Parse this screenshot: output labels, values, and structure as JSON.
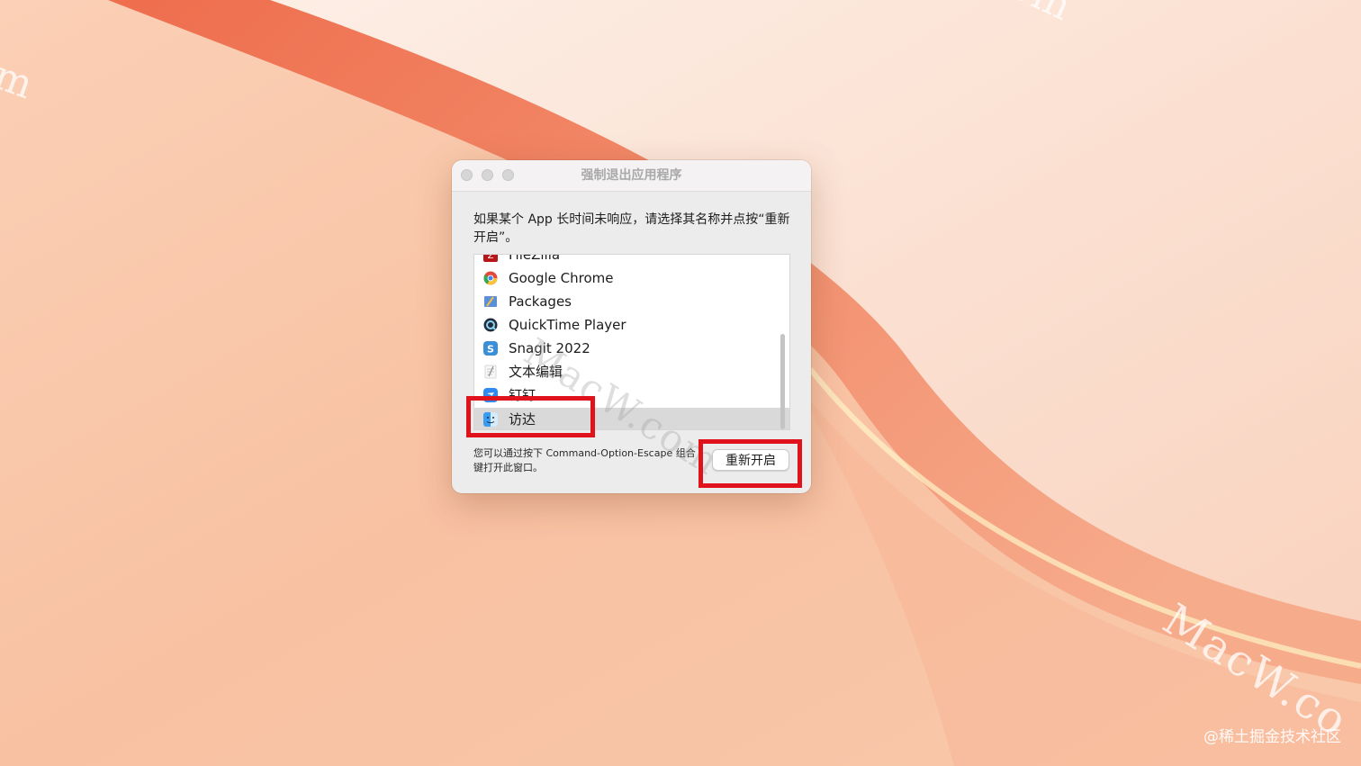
{
  "wallpaper": {
    "colors": [
      "#fbd3bc",
      "#f9c4a3",
      "#f38a6b",
      "#fdebe1"
    ]
  },
  "watermarks": {
    "top_left": "m",
    "top_right": "om",
    "bottom_right": "MacW.co",
    "center": "MacW.com"
  },
  "credit": "@稀土掘金技术社区",
  "dialog": {
    "title": "强制退出应用程序",
    "message": "如果某个 App 长时间未响应，请选择其名称并点按“重新开启”。",
    "apps": [
      {
        "label": "FileZilla",
        "icon": "filezilla-icon",
        "color": "#b8161b"
      },
      {
        "label": "Google Chrome",
        "icon": "chrome-icon",
        "color": "#4285f4"
      },
      {
        "label": "Packages",
        "icon": "packages-icon",
        "color": "#5b8fd8"
      },
      {
        "label": "QuickTime Player",
        "icon": "quicktime-icon",
        "color": "#1f2e3a"
      },
      {
        "label": "Snagit 2022",
        "icon": "snagit-icon",
        "color": "#3b8fd6"
      },
      {
        "label": "文本编辑",
        "icon": "textedit-icon",
        "color": "#d8d8d8"
      },
      {
        "label": "钉钉",
        "icon": "dingtalk-icon",
        "color": "#2f8bf0"
      },
      {
        "label": "访达",
        "icon": "finder-icon",
        "color": "#3a9cf0",
        "selected": true
      }
    ],
    "hint": "您可以通过按下 Command-Option-Escape 组合键打开此窗口。",
    "relaunch_label": "重新开启"
  },
  "annotation_color": "#e0131c"
}
